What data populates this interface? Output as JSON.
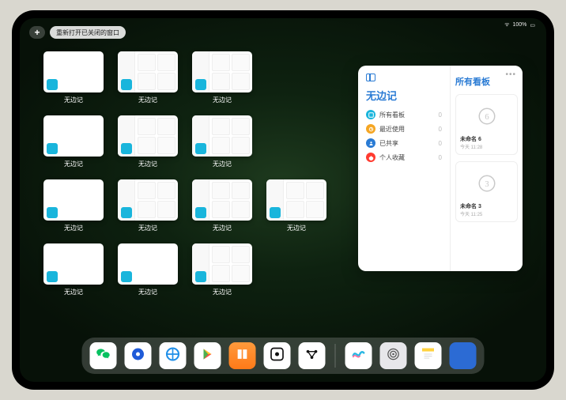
{
  "status": {
    "battery": "100%",
    "signal": "􀙇"
  },
  "top": {
    "plus": "+",
    "reopen_label": "重新打开已关闭的窗口"
  },
  "app_window_label": "无边记",
  "windows": [
    {
      "style": "blank"
    },
    {
      "style": "grid"
    },
    {
      "style": "grid"
    },
    null,
    {
      "style": "blank"
    },
    {
      "style": "grid"
    },
    {
      "style": "grid"
    },
    null,
    {
      "style": "blank"
    },
    {
      "style": "grid"
    },
    {
      "style": "grid"
    },
    {
      "style": "grid"
    },
    {
      "style": "blank"
    },
    {
      "style": "blank"
    },
    {
      "style": "grid"
    }
  ],
  "panel": {
    "left_title": "无边记",
    "right_title": "所有看板",
    "items": [
      {
        "label": "所有看板",
        "count": "0",
        "color": "#19b5dc"
      },
      {
        "label": "最近使用",
        "count": "0",
        "color": "#f5a623"
      },
      {
        "label": "已共享",
        "count": "0",
        "color": "#2a7bd4"
      },
      {
        "label": "个人收藏",
        "count": "0",
        "color": "#ff3b30"
      }
    ],
    "boards": [
      {
        "name": "未命名 6",
        "time": "今天 11:28",
        "glyph": "6"
      },
      {
        "name": "未命名 3",
        "time": "今天 11:25",
        "glyph": "3"
      }
    ]
  },
  "dock": [
    {
      "name": "wechat",
      "cls": "a-wechat"
    },
    {
      "name": "music",
      "cls": "a-qmusic"
    },
    {
      "name": "browser",
      "cls": "a-browser"
    },
    {
      "name": "play",
      "cls": "a-play"
    },
    {
      "name": "books",
      "cls": "a-books"
    },
    {
      "name": "camera",
      "cls": "a-camera"
    },
    {
      "name": "graph",
      "cls": "a-xx"
    },
    {
      "sep": true
    },
    {
      "name": "freeform",
      "cls": "a-freeform"
    },
    {
      "name": "settings",
      "cls": "a-settings"
    },
    {
      "name": "notes",
      "cls": "a-notes"
    },
    {
      "name": "app-folder",
      "cls": "a-folder"
    }
  ]
}
